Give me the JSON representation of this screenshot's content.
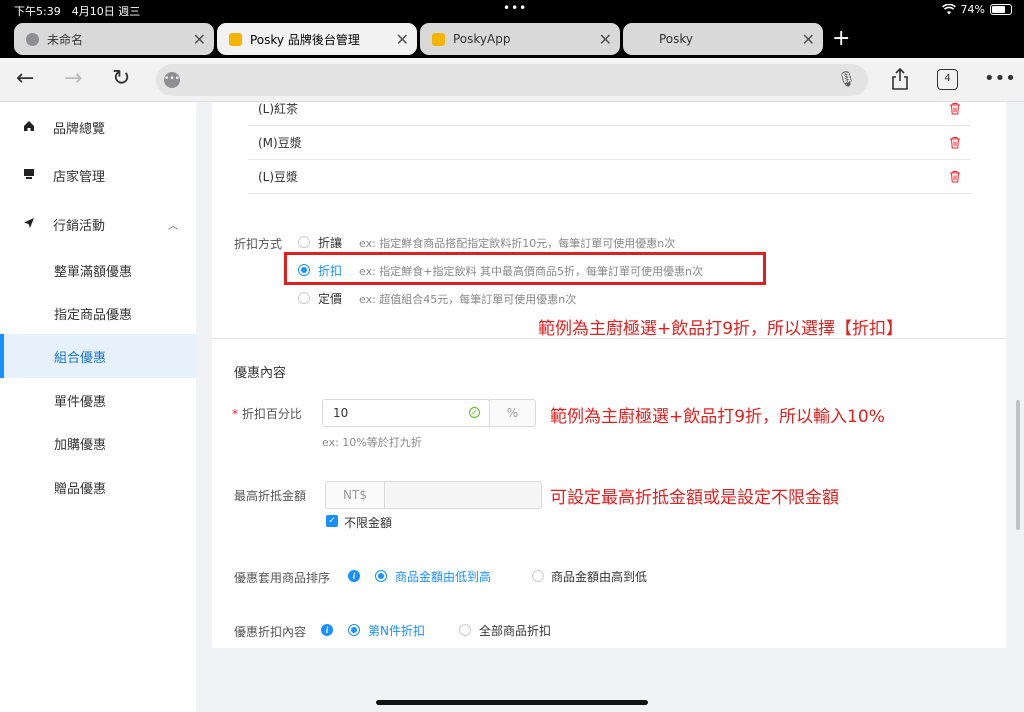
{
  "status": {
    "time": "下午5:39　4月10日 週三",
    "battery": "74%",
    "battery_level": 0.74
  },
  "tabs": [
    {
      "title": "未命名",
      "favicon_color": "#8e8e93",
      "active": false
    },
    {
      "title": "Posky 品牌後台管理",
      "favicon_color": "#f4b400",
      "active": true
    },
    {
      "title": "PoskyApp",
      "favicon_color": "#f4b400",
      "active": false
    },
    {
      "title": "Posky",
      "favicon_color": "",
      "active": false
    }
  ],
  "browser": {
    "tab_count": "4"
  },
  "sidebar": {
    "items": [
      {
        "label": "品牌總覽",
        "icon": "home-icon"
      },
      {
        "label": "店家管理",
        "icon": "store-icon"
      },
      {
        "label": "行銷活動",
        "icon": "send-icon"
      },
      {
        "label": "整單滿額優惠"
      },
      {
        "label": "指定商品優惠"
      },
      {
        "label": "組合優惠"
      },
      {
        "label": "單件優惠"
      },
      {
        "label": "加購優惠"
      },
      {
        "label": "贈品優惠"
      }
    ]
  },
  "products": [
    "(L)紅茶",
    "(M)豆漿",
    "(L)豆漿"
  ],
  "discount_method": {
    "label": "折扣方式",
    "options": [
      {
        "label": "折讓",
        "hint": "ex: 指定鮮食商品搭配指定飲料折10元，每筆訂單可使用優惠n次",
        "selected": false
      },
      {
        "label": "折扣",
        "hint": "ex: 指定鮮食+指定飲料 其中最高價商品5折，每筆訂單可使用優惠n次",
        "selected": true
      },
      {
        "label": "定價",
        "hint": "ex: 超值組合45元，每筆訂單可使用優惠n次",
        "selected": false
      }
    ]
  },
  "annotations": {
    "method": "範例為主廚極選+飲品打9折，所以選擇【折扣】",
    "percent": "範例為主廚極選+飲品打9折，所以輸入10%",
    "max": "可設定最高折抵金額或是設定不限金額"
  },
  "offer": {
    "section_title": "優惠內容",
    "percent_label": "折扣百分比",
    "required_mark": "*",
    "percent_value": "10",
    "percent_unit": "%",
    "percent_hint": "ex: 10%等於打九折",
    "max_label": "最高折抵金額",
    "max_prefix": "NT$",
    "no_limit_label": "不限金額",
    "sort_label": "優惠套用商品排序",
    "sort_options": [
      "商品金額由低到高",
      "商品金額由高到低"
    ],
    "content_label": "優惠折扣內容",
    "content_options": [
      "第N件折扣",
      "全部商品折扣"
    ]
  },
  "colors": {
    "accent": "#1890ff",
    "annotation": "#e02020",
    "active_bg": "#e6f1fb"
  }
}
